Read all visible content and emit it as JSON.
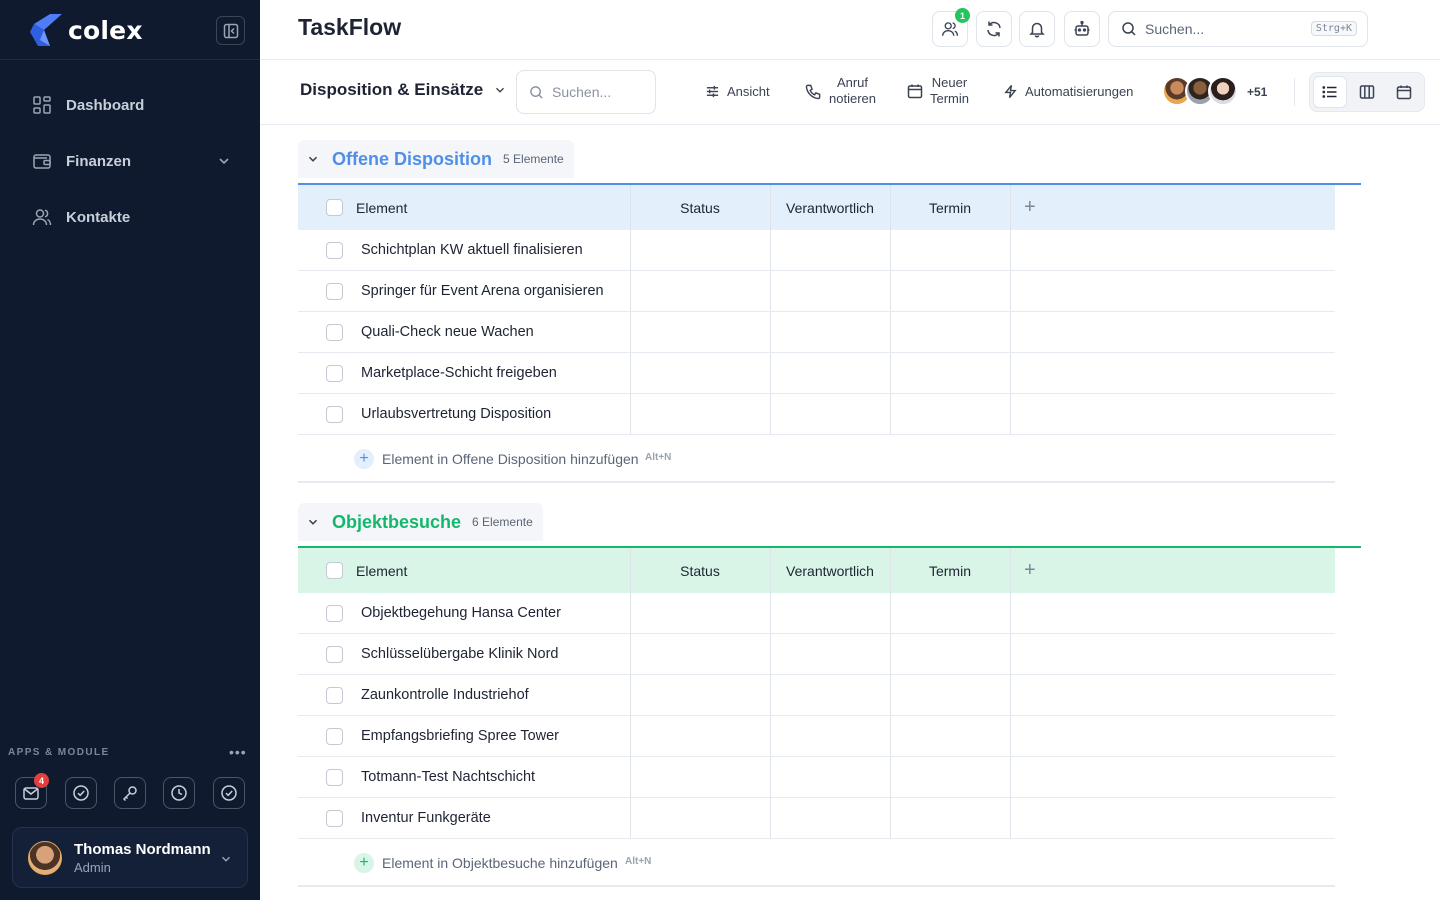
{
  "sidebar": {
    "logo_text": "colex",
    "nav": [
      {
        "label": "Dashboard",
        "icon": "dashboard-icon"
      },
      {
        "label": "Finanzen",
        "icon": "wallet-icon",
        "expandable": true
      },
      {
        "label": "Kontakte",
        "icon": "users-icon"
      }
    ],
    "apps_label": "APPS & MODULE",
    "apps_more": "•••",
    "apps": [
      {
        "icon": "mail-icon",
        "badge": "4"
      },
      {
        "icon": "check-circle-icon"
      },
      {
        "icon": "key-icon"
      },
      {
        "icon": "clock-icon"
      },
      {
        "icon": "check-badge-icon"
      }
    ],
    "user": {
      "name": "Thomas Nordmann",
      "role": "Admin"
    }
  },
  "header": {
    "title": "TaskFlow",
    "team_badge": "1",
    "search_placeholder": "Suchen...",
    "search_shortcut": "Strg+K"
  },
  "toolbar": {
    "board_name": "Disposition & Einsätze",
    "search_placeholder": "Suchen...",
    "view_label": "Ansicht",
    "call_label_1": "Anruf",
    "call_label_2": "notieren",
    "appt_label_1": "Neuer",
    "appt_label_2": "Termin",
    "automations_label": "Automatisierungen",
    "members_more": "+51"
  },
  "columns": [
    "Element",
    "Status",
    "Verantwortlich",
    "Termin"
  ],
  "groups": [
    {
      "title": "Offene Disposition",
      "count": "5 Elemente",
      "color": "#4f8fe8",
      "header_bg": "#e4effc",
      "add_label": "Element in Offene Disposition hinzufügen",
      "add_shortcut": "Alt+N",
      "items": [
        "Schichtplan KW aktuell finalisieren",
        "Springer für Event Arena organisieren",
        "Quali-Check neue Wachen",
        "Marketplace-Schicht freigeben",
        "Urlaubsvertretung Disposition"
      ]
    },
    {
      "title": "Objektbesuche",
      "count": "6 Elemente",
      "color": "#13b86c",
      "header_bg": "#d8f5e7",
      "add_label": "Element in Objektbesuche hinzufügen",
      "add_shortcut": "Alt+N",
      "items": [
        "Objektbegehung Hansa Center",
        "Schlüsselübergabe Klinik Nord",
        "Zaunkontrolle Industriehof",
        "Empfangsbriefing Spree Tower",
        "Totmann-Test Nachtschicht",
        "Inventur Funkgeräte"
      ]
    }
  ]
}
